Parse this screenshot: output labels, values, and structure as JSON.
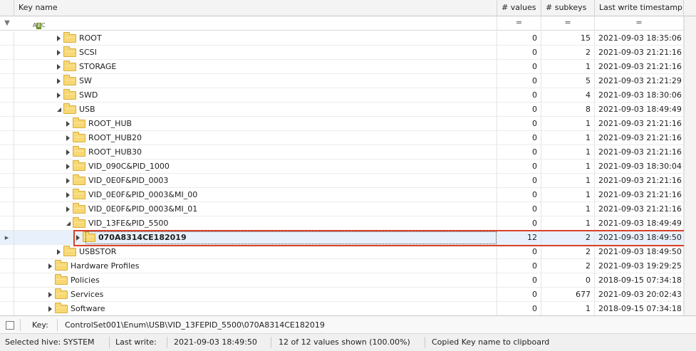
{
  "columns": {
    "key_name": "Key name",
    "values": "# values",
    "subkeys": "# subkeys",
    "timestamp": "Last write timestamp"
  },
  "filter": {
    "equals": "="
  },
  "rows": [
    {
      "name": "ROOT",
      "values": "0",
      "subkeys": "15",
      "timestamp": "2021-09-03 18:35:06",
      "level": 2,
      "state": "collapsed"
    },
    {
      "name": "SCSI",
      "values": "0",
      "subkeys": "2",
      "timestamp": "2021-09-03 21:21:16",
      "level": 2,
      "state": "collapsed"
    },
    {
      "name": "STORAGE",
      "values": "0",
      "subkeys": "1",
      "timestamp": "2021-09-03 21:21:16",
      "level": 2,
      "state": "collapsed"
    },
    {
      "name": "SW",
      "values": "0",
      "subkeys": "5",
      "timestamp": "2021-09-03 21:21:29",
      "level": 2,
      "state": "collapsed"
    },
    {
      "name": "SWD",
      "values": "0",
      "subkeys": "4",
      "timestamp": "2021-09-03 18:30:06",
      "level": 2,
      "state": "collapsed"
    },
    {
      "name": "USB",
      "values": "0",
      "subkeys": "8",
      "timestamp": "2021-09-03 18:49:49",
      "level": 2,
      "state": "expanded"
    },
    {
      "name": "ROOT_HUB",
      "values": "0",
      "subkeys": "1",
      "timestamp": "2021-09-03 21:21:16",
      "level": 3,
      "state": "collapsed"
    },
    {
      "name": "ROOT_HUB20",
      "values": "0",
      "subkeys": "1",
      "timestamp": "2021-09-03 21:21:16",
      "level": 3,
      "state": "collapsed"
    },
    {
      "name": "ROOT_HUB30",
      "values": "0",
      "subkeys": "1",
      "timestamp": "2021-09-03 21:21:16",
      "level": 3,
      "state": "collapsed"
    },
    {
      "name": "VID_090C&PID_1000",
      "values": "0",
      "subkeys": "1",
      "timestamp": "2021-09-03 18:30:04",
      "level": 3,
      "state": "collapsed"
    },
    {
      "name": "VID_0E0F&PID_0003",
      "values": "0",
      "subkeys": "1",
      "timestamp": "2021-09-03 21:21:16",
      "level": 3,
      "state": "collapsed"
    },
    {
      "name": "VID_0E0F&PID_0003&MI_00",
      "values": "0",
      "subkeys": "1",
      "timestamp": "2021-09-03 21:21:16",
      "level": 3,
      "state": "collapsed"
    },
    {
      "name": "VID_0E0F&PID_0003&MI_01",
      "values": "0",
      "subkeys": "1",
      "timestamp": "2021-09-03 21:21:16",
      "level": 3,
      "state": "collapsed"
    },
    {
      "name": "VID_13FE&PID_5500",
      "values": "0",
      "subkeys": "1",
      "timestamp": "2021-09-03 18:49:49",
      "level": 3,
      "state": "expanded"
    },
    {
      "name": "070A8314CE182019",
      "values": "12",
      "subkeys": "2",
      "timestamp": "2021-09-03 18:49:50",
      "level": 4,
      "state": "collapsed",
      "selected": true
    },
    {
      "name": "USBSTOR",
      "values": "0",
      "subkeys": "2",
      "timestamp": "2021-09-03 18:49:50",
      "level": 2,
      "state": "collapsed"
    },
    {
      "name": "Hardware Profiles",
      "values": "0",
      "subkeys": "2",
      "timestamp": "2021-09-03 19:29:25",
      "level": 1,
      "state": "collapsed"
    },
    {
      "name": "Policies",
      "values": "0",
      "subkeys": "0",
      "timestamp": "2018-09-15 07:34:18",
      "level": 1,
      "state": "none"
    },
    {
      "name": "Services",
      "values": "0",
      "subkeys": "677",
      "timestamp": "2021-09-03 20:02:43",
      "level": 1,
      "state": "collapsed"
    },
    {
      "name": "Software",
      "values": "0",
      "subkeys": "1",
      "timestamp": "2018-09-15 07:34:18",
      "level": 1,
      "state": "collapsed"
    }
  ],
  "keybar": {
    "label": "Key:",
    "path": "ControlSet001\\Enum\\USB\\VID_13FEPID_5500\\070A8314CE182019"
  },
  "status": {
    "hive": "Selected hive: SYSTEM",
    "last_write_label": "Last write:",
    "last_write_value": "2021-09-03 18:49:50",
    "values_shown": "12 of 12 values shown (100.00%)",
    "message": "Copied Key name to clipboard"
  },
  "colors": {
    "folder": "#f7d874",
    "selection": "#e8f1fb",
    "highlight_box": "#d9402b"
  }
}
